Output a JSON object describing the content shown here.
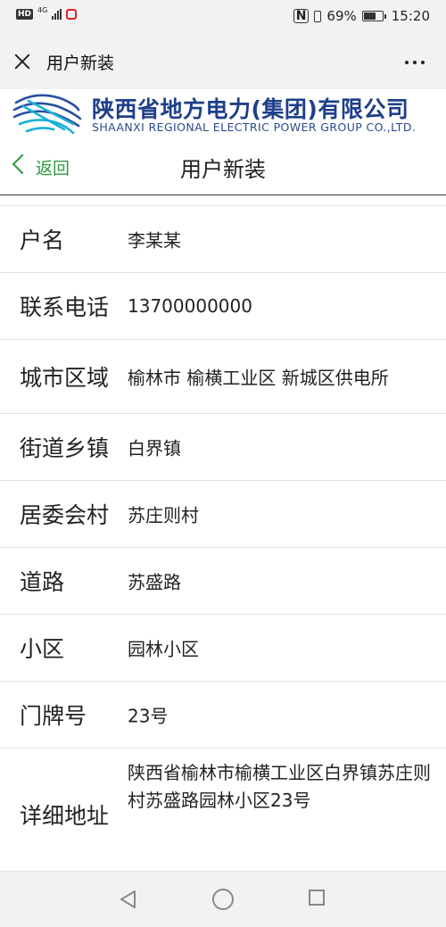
{
  "status_bar": {
    "hd": "HD",
    "network": "4G",
    "battery": "69%",
    "time": "15:20",
    "nfc": "N"
  },
  "wechat_bar": {
    "title": "用户新装"
  },
  "banner": {
    "company_cn": "陕西省地方电力(集团)有限公司",
    "company_en": "SHAANXI REGIONAL ELECTRIC POWER GROUP CO.,LTD."
  },
  "page_nav": {
    "back_label": "返回",
    "title": "用户新装"
  },
  "form": {
    "rows": [
      {
        "label": "户名",
        "value": "李某某"
      },
      {
        "label": "联系电话",
        "value": "13700000000"
      },
      {
        "label": "城市区域",
        "value": "榆林市 榆横工业区 新城区供电所"
      },
      {
        "label": "街道乡镇",
        "value": "白界镇"
      },
      {
        "label": "居委会村",
        "value": "苏庄则村"
      },
      {
        "label": "道路",
        "value": "苏盛路"
      },
      {
        "label": "小区",
        "value": "园林小区"
      },
      {
        "label": "门牌号",
        "value": "23号"
      },
      {
        "label": "详细地址",
        "value": "陕西省榆林市榆横工业区白界镇苏庄则村苏盛路园林小区23号"
      }
    ]
  },
  "colors": {
    "accent_green": "#2c9b3c",
    "brand_blue": "#1e3f8a"
  }
}
